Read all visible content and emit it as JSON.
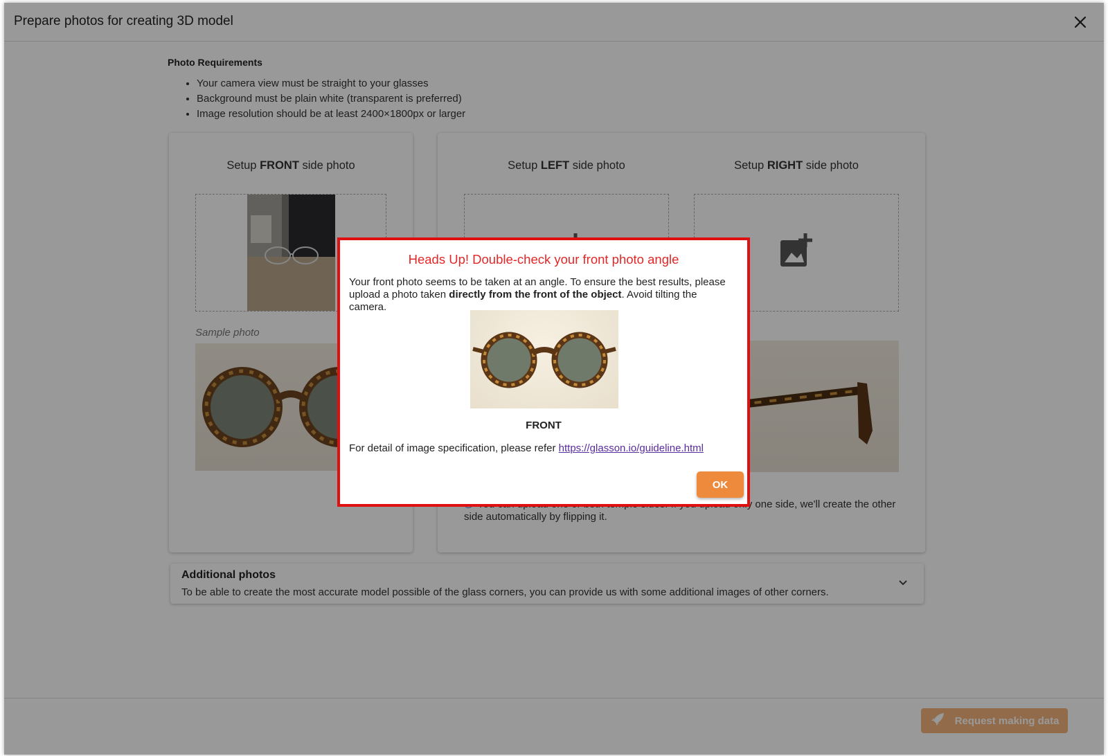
{
  "header": {
    "title": "Prepare photos for creating 3D model"
  },
  "requirements": {
    "title": "Photo Requirements",
    "items": [
      "Your camera view must be straight to your glasses",
      "Background must be plain white (transparent is preferred)",
      "Image resolution should be at least 2400×1800px or larger"
    ]
  },
  "front": {
    "label_prefix": "Setup ",
    "label_bold": "FRONT",
    "label_suffix": " side photo",
    "sample_label": "Sample photo"
  },
  "left": {
    "label_prefix": "Setup ",
    "label_bold": "LEFT",
    "label_suffix": " side photo"
  },
  "right": {
    "label_prefix": "Setup ",
    "label_bold": "RIGHT",
    "label_suffix": " side photo"
  },
  "sides_note": "You can upload one or both temple sides. If you upload only one side, we'll create the other side automatically by flipping it.",
  "additional": {
    "title": "Additional photos",
    "description": "To be able to create the most accurate model possible of the glass corners, you can provide us with some additional images of other corners."
  },
  "footer": {
    "request_label": "Request making data"
  },
  "modal": {
    "title": "Heads Up! Double-check your front photo angle",
    "body_1": "Your front photo seems to be taken at an angle. To ensure the best results, please upload a photo taken ",
    "body_bold": "directly from the front of the object",
    "body_2": ". Avoid tilting the camera.",
    "caption": "FRONT",
    "ref_text": "For detail of image specification, please refer ",
    "ref_link": "https://glasson.io/guideline.html",
    "ok_label": "OK"
  },
  "colors": {
    "modal_title": "#e32727",
    "modal_border": "#e01010",
    "ok_button": "#ee8a3c",
    "link": "#5a2ba0"
  },
  "icons": [
    "close-icon",
    "add-photo-icon",
    "info-icon",
    "chevron-down-icon",
    "rocket-icon"
  ]
}
